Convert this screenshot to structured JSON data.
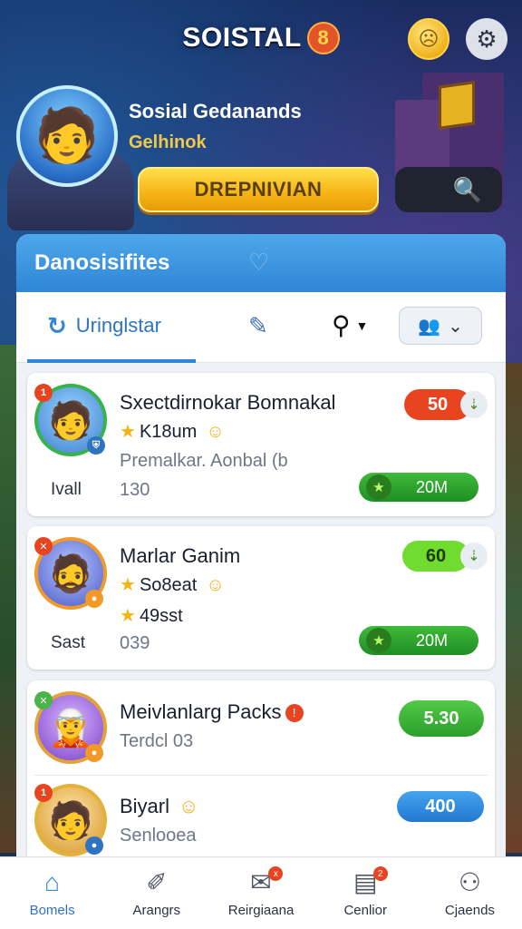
{
  "header": {
    "app_title": "SOISTAL",
    "title_badge": "8",
    "coin_icon": "coin-face-icon",
    "settings_icon": "gear-icon"
  },
  "hero": {
    "name": "Sosial Gedanands",
    "subtitle": "Gelhinok",
    "action_label": "DREPNIVIAN",
    "search_icon": "search-icon"
  },
  "panel": {
    "title": "Danosisifites",
    "tabs": {
      "active_label": "Uringlstar",
      "filter_icon": "chevron-down-icon",
      "people_icon": "people-icon"
    }
  },
  "cards": [
    {
      "name": "Sxectdirnokar Bomnakal",
      "line1": "K18um",
      "line2": "Premalkar. Aonbal (b",
      "left_label": "Ivall",
      "num": "130",
      "pill": "50",
      "bar": "20M",
      "pill_color": "#e84420"
    },
    {
      "name": "Marlar Ganim",
      "line1": "So8eat",
      "line2": "49sst",
      "left_label": "Sast",
      "num": "039",
      "pill": "60",
      "bar": "20M",
      "pill_color": "#6fdc2f"
    },
    {
      "name": "Meivlanlarg Packs",
      "line1": "Terdcl 03",
      "pill": "5.30"
    },
    {
      "name": "Biyarl",
      "line1": "Senlooea",
      "pill": "400"
    }
  ],
  "bottom_nav": [
    {
      "label": "Bomels",
      "icon": "home-icon",
      "active": true
    },
    {
      "label": "Arangrs",
      "icon": "tag-icon",
      "active": false
    },
    {
      "label": "Reirgiaana",
      "icon": "chat-icon",
      "active": false,
      "badge": "x"
    },
    {
      "label": "Cenlior",
      "icon": "inbox-icon",
      "active": false,
      "badge": "2"
    },
    {
      "label": "Cjaends",
      "icon": "user-icon",
      "active": false
    }
  ]
}
